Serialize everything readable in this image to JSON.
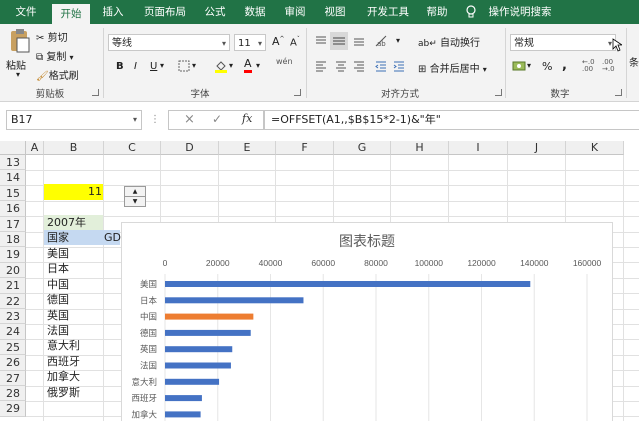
{
  "tabs": [
    "文件",
    "开始",
    "插入",
    "页面布局",
    "公式",
    "数据",
    "审阅",
    "视图",
    "开发工具",
    "帮助",
    "操作说明搜索"
  ],
  "ribbon": {
    "clipboard": {
      "paste": "粘贴",
      "cut": "剪切",
      "copy": "复制",
      "format_painter": "格式刷",
      "label": "剪贴板"
    },
    "font": {
      "name": "等线",
      "size": "11",
      "bold": "B",
      "italic": "I",
      "underline": "U",
      "grow": "A",
      "shrink": "A",
      "font_color": "A",
      "phonetic": "wén",
      "label": "字体"
    },
    "alignment": {
      "wrap": "自动换行",
      "merge": "合并后居中",
      "label": "对齐方式"
    },
    "number": {
      "format": "常规",
      "percent": "%",
      "comma": ",",
      "label": "数字"
    },
    "cut_off": "条"
  },
  "formula_bar": {
    "name_box": "B17",
    "cancel": "×",
    "enter": "✓",
    "fx": "fx",
    "formula": "=OFFSET(A1,,$B$15*2-1)&\"年\""
  },
  "columns": [
    "A",
    "B",
    "C",
    "D",
    "E",
    "F",
    "G",
    "H",
    "I",
    "J",
    "K"
  ],
  "rows": [
    "13",
    "14",
    "15",
    "16",
    "17",
    "18",
    "19",
    "20",
    "21",
    "22",
    "23",
    "24",
    "25",
    "26",
    "27",
    "28",
    "29"
  ],
  "cells": {
    "b15": "11",
    "b17": "2007年",
    "b18": "国家",
    "c18": "GD",
    "countries": [
      "美国",
      "日本",
      "中国",
      "德国",
      "英国",
      "法国",
      "意大利",
      "西班牙",
      "加拿大",
      "俄罗斯"
    ]
  },
  "chart_data": {
    "type": "bar",
    "orientation": "horizontal",
    "title": "图表标题",
    "categories": [
      "美国",
      "日本",
      "中国",
      "德国",
      "英国",
      "法国",
      "意大利",
      "西班牙",
      "加拿大"
    ],
    "values": [
      138500,
      52500,
      33500,
      32500,
      25500,
      25000,
      20500,
      14000,
      13500
    ],
    "highlight_category": "中国",
    "xlim": [
      0,
      160000
    ],
    "xticks": [
      "0",
      "20000",
      "40000",
      "60000",
      "80000",
      "100000",
      "120000",
      "140000",
      "160000"
    ],
    "gridlines": true,
    "colors": {
      "bar": "#4472c4",
      "highlight": "#ed7d31"
    }
  },
  "colors": {
    "accent": "#217346",
    "highlight_cell": "#ffff00",
    "selected_cell": "#e2efda"
  }
}
